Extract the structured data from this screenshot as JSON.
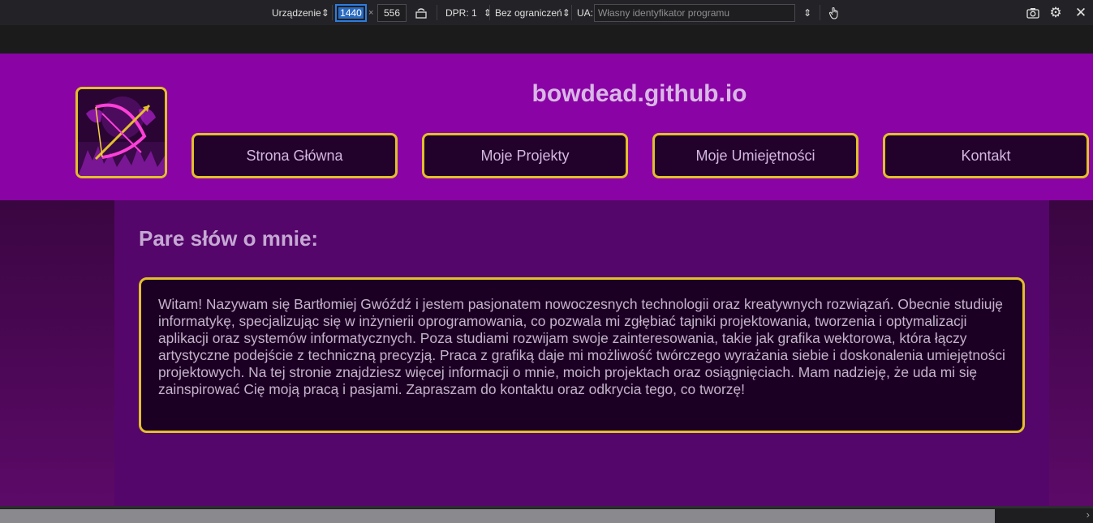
{
  "toolbar": {
    "device_label": "Urządzenie",
    "width_value": "1440",
    "times": "×",
    "height_value": "556",
    "dpr_label": "DPR: 1",
    "throttle_label": "Bez ograniczeń",
    "ua_label": "UA:",
    "ua_placeholder": "Własny identyfikator programu",
    "icons": [
      "rotate-icon",
      "touch-icon",
      "screenshot-icon",
      "settings-icon",
      "close-icon"
    ]
  },
  "site": {
    "title": "bowdead.github.io",
    "nav": [
      {
        "label": "Strona Główna"
      },
      {
        "label": "Moje Projekty"
      },
      {
        "label": "Moje Umiejętności"
      },
      {
        "label": "Kontakt"
      }
    ],
    "section_heading": "Pare słów o mnie:",
    "about_text": "Witam! Nazywam się Bartłomiej Gwóźdź i jestem pasjonatem nowoczesnych technologii oraz kreatywnych rozwiązań. Obecnie studiuję informatykę, specjalizując się w inżynierii oprogramowania, co pozwala mi zgłębiać tajniki projektowania, tworzenia i optymalizacji aplikacji oraz systemów informatycznych. Poza studiami rozwijam swoje zainteresowania, takie jak grafika wektorowa, która łączy artystyczne podejście z techniczną precyzją. Praca z grafiką daje mi możliwość twórczego wyrażania siebie i doskonalenia umiejętności projektowych. Na tej stronie znajdziesz więcej informacji o mnie, moich projektach oraz osiągnięciach. Mam nadzieję, że uda mi się zainspirować Cię moją pracą i pasjami. Zapraszam do kontaktu oraz odkrycia tego, co tworzę!"
  },
  "colors": {
    "header_bg": "#8a03a5",
    "panel_bg": "#55066a",
    "accent_border": "#e2bf2c",
    "button_bg": "#22012b"
  }
}
